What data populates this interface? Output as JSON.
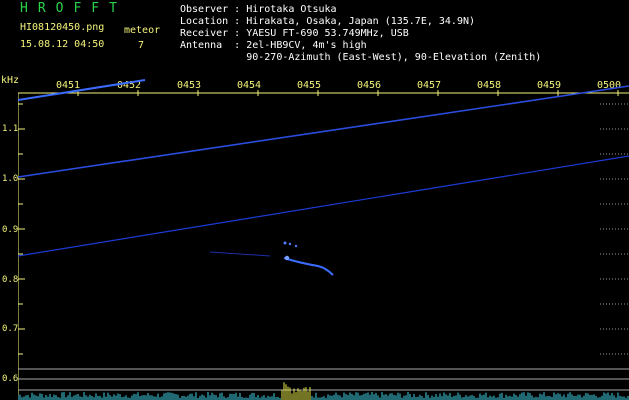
{
  "header": {
    "logo": "HROFFT",
    "filename": "HI08120450.png",
    "datetime": "15.08.12 04:50",
    "meteor_label": "meteor",
    "meteor_count": "7"
  },
  "info": {
    "observer": "Observer : Hirotaka Otsuka",
    "location": "Location : Hirakata, Osaka, Japan (135.7E, 34.9N)",
    "receiver": "Receiver : YAESU FT-690 53.749MHz, USB",
    "antenna": "Antenna  : 2el-HB9CV, 4m's high",
    "antenna2": "           90-270-Azimuth (East-West), 90-Elevation (Zenith)"
  },
  "axis": {
    "y_unit": "kHz",
    "y_ticks": [
      "1.1",
      "1.0",
      "0.9",
      "0.8",
      "0.7",
      "0.6"
    ],
    "x_ticks": [
      "0451",
      "0452",
      "0453",
      "0454",
      "0455",
      "0456",
      "0457",
      "0458",
      "0459",
      "0500"
    ]
  },
  "colors": {
    "background": "#000000",
    "label_yellow": "#f4f47a",
    "logo_green": "#2bd34a",
    "trace_blue": "#1b3bd6",
    "noise_cyan": "#3fd2e6",
    "echo_yellow": "#e8e84a"
  }
}
